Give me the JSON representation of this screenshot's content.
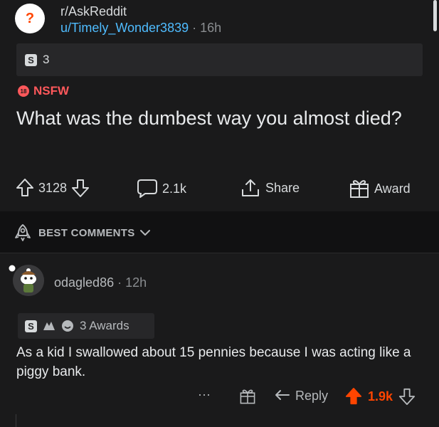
{
  "post": {
    "subreddit": "r/AskReddit",
    "author": "u/Timely_Wonder3839",
    "separator": "·",
    "age": "16h",
    "flair_count": "3",
    "nsfw_label": "NSFW",
    "nsfw_badge": "18",
    "title": "What was the dumbest way you almost died?",
    "upvotes": "3128",
    "comments": "2.1k",
    "share_label": "Share",
    "award_label": "Award"
  },
  "sort": {
    "label": "BEST COMMENTS"
  },
  "comment": {
    "author": "odagled86",
    "separator": "·",
    "age": "12h",
    "awards_label": "3 Awards",
    "text": "As a kid I swallowed about 15 pennies because I was acting like a piggy bank.",
    "more_label": "···",
    "reply_label": "Reply",
    "score": "1.9k"
  },
  "colors": {
    "background": "#1a1a1b",
    "nsfw": "#ff585b",
    "upvote_active": "#ff4500",
    "username_link": "#4fbcff"
  },
  "icons": {
    "subreddit": "askreddit-snoo-icon",
    "upvote": "upvote-arrow-icon",
    "downvote": "downvote-arrow-icon",
    "comment": "comment-bubble-icon",
    "share": "share-icon",
    "award": "gift-icon",
    "sort": "rocket-icon"
  }
}
